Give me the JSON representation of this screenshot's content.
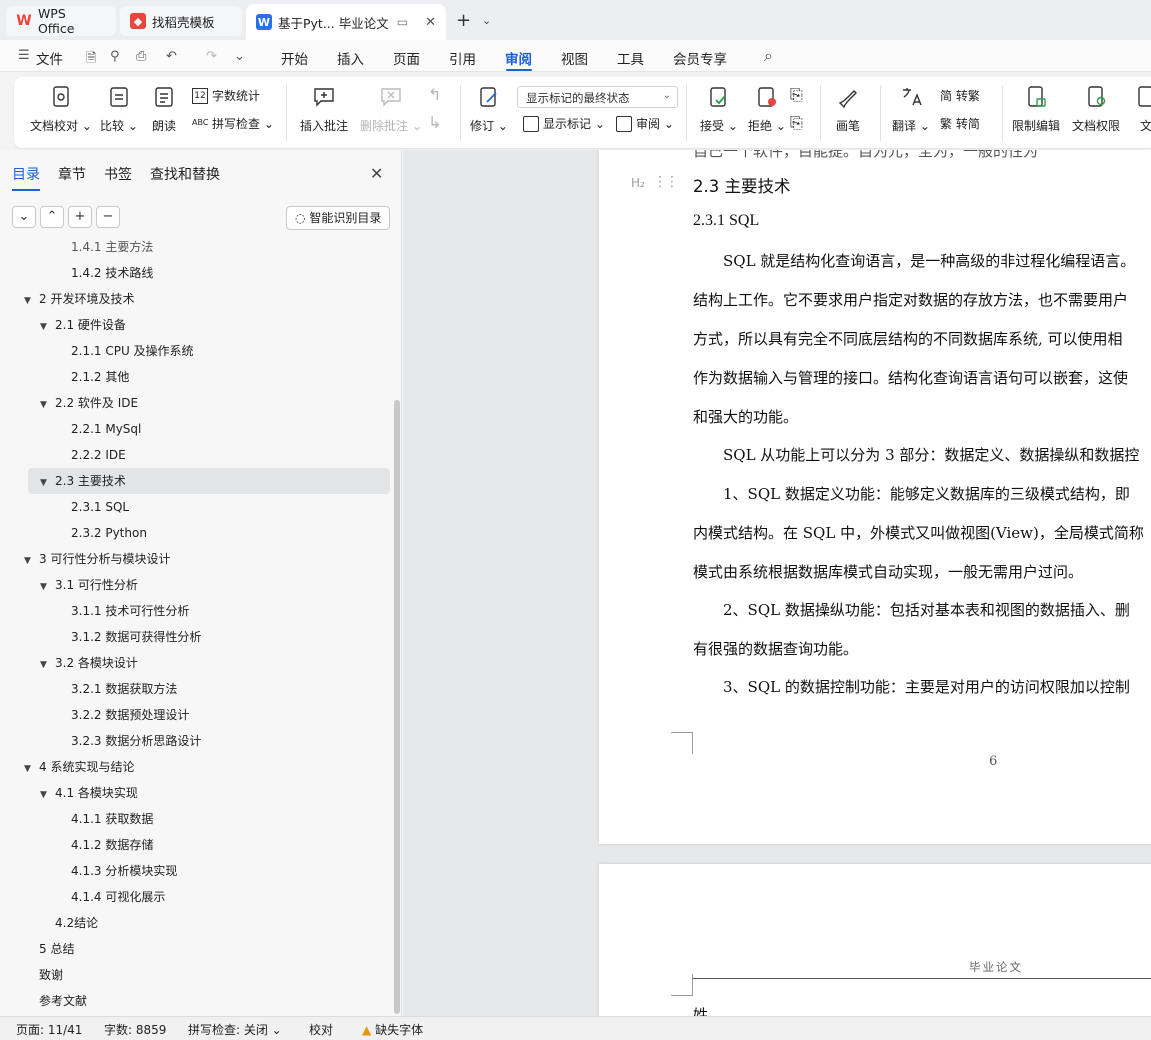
{
  "titlebar": {
    "tabs": [
      {
        "label": "WPS Office"
      },
      {
        "label": "找稻壳模板"
      },
      {
        "label": "基于Pyt... 毕业论文"
      }
    ],
    "new_tab_icon": "plus-icon"
  },
  "menu": {
    "file": "文件",
    "items": [
      "开始",
      "插入",
      "页面",
      "引用",
      "审阅",
      "视图",
      "工具",
      "会员专享"
    ],
    "active": "审阅"
  },
  "ribbon": {
    "doc_proof": "文档校对",
    "compare": "比较",
    "read_aloud": "朗读",
    "word_count": "字数统计",
    "spell_check": "拼写检查",
    "insert_comment": "插入批注",
    "delete_comment": "删除批注",
    "revise": "修订",
    "display_state": "显示标记的最终状态",
    "show_markup": "显示标记",
    "review": "审阅",
    "accept": "接受",
    "reject": "拒绝",
    "pen": "画笔",
    "translate": "翻译",
    "to_traditional": "简 转繁",
    "to_simplified": "繁 转简",
    "restrict_edit": "限制编辑",
    "doc_permission": "文档权限",
    "doc_more": "文"
  },
  "left_panel": {
    "tabs": [
      "目录",
      "章节",
      "书签",
      "查找和替换"
    ],
    "smart_toc": "智能识别目录",
    "toc": [
      {
        "text": "1.4.1 主要方法",
        "level": 3,
        "partial": true
      },
      {
        "text": "1.4.2  技术路线",
        "level": 3
      },
      {
        "text": "2 开发环境及技术",
        "level": 1,
        "expanded": true
      },
      {
        "text": "2.1 硬件设备",
        "level": 2,
        "expanded": true
      },
      {
        "text": "2.1.1 CPU 及操作系统",
        "level": 3
      },
      {
        "text": "2.1.2  其他",
        "level": 3
      },
      {
        "text": "2.2 软件及 IDE",
        "level": 2,
        "expanded": true
      },
      {
        "text": "2.2.1 MySql",
        "level": 3
      },
      {
        "text": "2.2.2 IDE",
        "level": 3
      },
      {
        "text": "2.3 主要技术",
        "level": 2,
        "expanded": true,
        "selected": true
      },
      {
        "text": "2.3.1 SQL",
        "level": 3
      },
      {
        "text": "2.3.2 Python",
        "level": 3
      },
      {
        "text": "3  可行性分析与模块设计",
        "level": 1,
        "expanded": true
      },
      {
        "text": "3.1  可行性分析",
        "level": 2,
        "expanded": true
      },
      {
        "text": "3.1.1  技术可行性分析",
        "level": 3
      },
      {
        "text": "3.1.2  数据可获得性分析",
        "level": 3
      },
      {
        "text": "3.2  各模块设计",
        "level": 2,
        "expanded": true
      },
      {
        "text": "3.2.1  数据获取方法",
        "level": 3
      },
      {
        "text": "3.2.2  数据预处理设计",
        "level": 3
      },
      {
        "text": "3.2.3  数据分析思路设计",
        "level": 3
      },
      {
        "text": "4  系统实现与结论",
        "level": 1,
        "expanded": true
      },
      {
        "text": "4.1  各模块实现",
        "level": 2,
        "expanded": true
      },
      {
        "text": "4.1.1  获取数据",
        "level": 3
      },
      {
        "text": "4.1.2  数据存储",
        "level": 3
      },
      {
        "text": "4.1.3  分析模块实现",
        "level": 3
      },
      {
        "text": "4.1.4  可视化展示",
        "level": 3
      },
      {
        "text": "4.2结论",
        "level": 2
      },
      {
        "text": "5 总结",
        "level": 1
      },
      {
        "text": "致谢",
        "level": 1
      },
      {
        "text": "参考文献",
        "level": 1
      }
    ]
  },
  "document": {
    "top_partial": "自己一个软件，目能提。自为元，全为，一般的性为",
    "heading2": "2.3 主要技术",
    "heading_mark": "H₂",
    "heading3": "2.3.1 SQL",
    "lines": [
      "　　SQL 就是结构化查询语言，是一种高级的非过程化编程语言。",
      "结构上工作。它不要求用户指定对数据的存放方法，也不需要用户",
      "方式，所以具有完全不同底层结构的不同数据库系统, 可以使用相",
      "作为数据输入与管理的接口。结构化查询语言语句可以嵌套，这使",
      "和强大的功能。",
      "　　SQL 从功能上可以分为 3 部分：数据定义、数据操纵和数据控",
      "　　1、SQL 数据定义功能：能够定义数据库的三级模式结构，即",
      "内模式结构。在 SQL 中，外模式又叫做视图(View)，全局模式简称",
      "模式由系统根据数据库模式自动实现，一般无需用户过问。",
      "　　2、SQL 数据操纵功能：包括对基本表和视图的数据插入、删",
      "有很强的数据查询功能。",
      "　　3、SQL 的数据控制功能：主要是对用户的访问权限加以控制"
    ],
    "page_number": "6",
    "page2_header": "毕业论文",
    "page2_text": "姓"
  },
  "status": {
    "page": "页面: 11/41",
    "words": "字数: 8859",
    "spell": "拼写检查: 关闭",
    "proof": "校对",
    "missing_font": "缺失字体"
  },
  "colors": {
    "accent": "#1d5fdc",
    "wps_red": "#e8453c",
    "docer_red": "#e8453c",
    "writer_blue": "#2b6ee6"
  }
}
